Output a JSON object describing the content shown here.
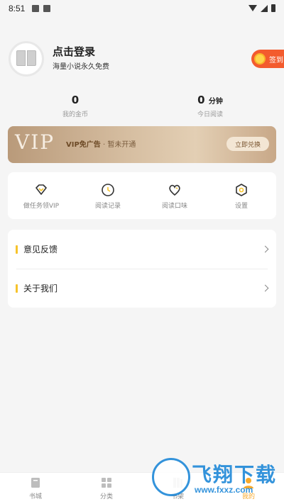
{
  "status_bar": {
    "time": "8:51"
  },
  "profile": {
    "login_title": "点击登录",
    "login_subtitle": "海量小说永久免费",
    "checkin_label": "签到"
  },
  "stats": [
    {
      "value": "0",
      "unit": "",
      "label": "我的金币"
    },
    {
      "value": "0",
      "unit": "分钟",
      "label": "今日阅读"
    }
  ],
  "vip_banner": {
    "logo": "VIP",
    "title": "VIP免广告",
    "subtitle": "· 暂未开通",
    "button_label": "立即兑换"
  },
  "menu_grid": [
    {
      "label": "做任务领VIP",
      "icon": "gem-icon"
    },
    {
      "label": "阅读记录",
      "icon": "clock-icon"
    },
    {
      "label": "阅读口味",
      "icon": "heart-icon"
    },
    {
      "label": "设置",
      "icon": "gear-icon"
    }
  ],
  "list": [
    {
      "label": "意见反馈"
    },
    {
      "label": "关于我们"
    }
  ],
  "bottom_nav": [
    {
      "label": "书城",
      "icon": "bookstore-icon",
      "active": false
    },
    {
      "label": "分类",
      "icon": "category-icon",
      "active": false
    },
    {
      "label": "书架",
      "icon": "bookshelf-icon",
      "active": false
    },
    {
      "label": "我的",
      "icon": "profile-icon",
      "active": true
    }
  ],
  "watermark": {
    "text": "飞翔下载",
    "url": "www.fxxz.com"
  },
  "colors": {
    "accent": "#f7c32b",
    "checkin": "#f35b2e",
    "active_nav": "#f7a92b",
    "watermark": "#1e88d8"
  }
}
